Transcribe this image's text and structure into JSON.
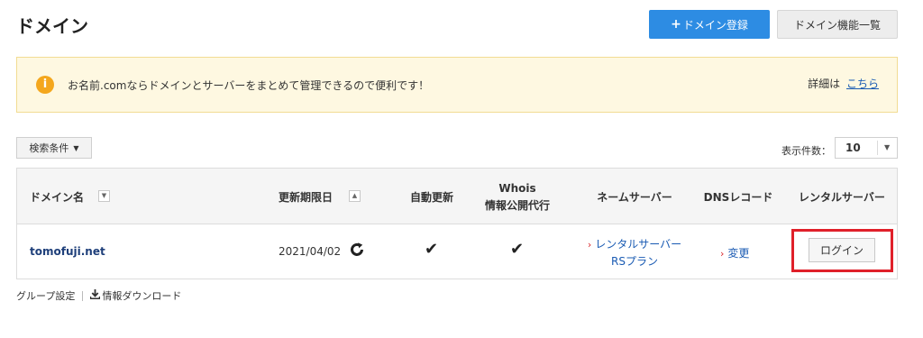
{
  "header": {
    "title": "ドメイン",
    "register_button": {
      "icon": "plus-icon",
      "label": "ドメイン登録"
    },
    "features_button": "ドメイン機能一覧"
  },
  "notice": {
    "icon": "info-icon",
    "message": "お名前.comならドメインとサーバーをまとめて管理できるので便利です！",
    "detail_prefix": "詳細は",
    "detail_link": "こちら"
  },
  "filters": {
    "search_conditions": "検索条件",
    "page_size_label": "表示件数：",
    "page_size_value": "10"
  },
  "table": {
    "headers": {
      "domain": "ドメイン名",
      "expiry": "更新期限日",
      "auto_renew": "自動更新",
      "whois_line1": "Whois",
      "whois_line2": "情報公開代行",
      "nameserver": "ネームサーバー",
      "dns": "DNSレコード",
      "rental": "レンタルサーバー"
    },
    "rows": [
      {
        "domain": "tomofuji.net",
        "expiry": "2021/04/02",
        "nameserver_line1": "レンタルサーバー",
        "nameserver_line2": "RSプラン",
        "dns_link": "変更",
        "rental_button": "ログイン"
      }
    ]
  },
  "footer": {
    "group_settings": "グループ設定",
    "download": "情報ダウンロード"
  },
  "colors": {
    "primary": "#2d8ce3",
    "notice_bg": "#fef8e1",
    "notice_icon": "#f4a71d",
    "highlight": "#e0202a",
    "link": "#1a5bb3",
    "domain_link": "#1e3f7a"
  }
}
